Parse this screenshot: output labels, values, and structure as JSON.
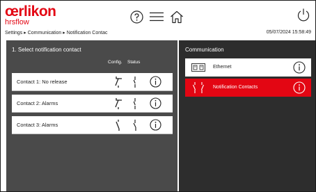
{
  "header": {
    "brand": "œrlikon",
    "product": "hrsflow",
    "breadcrumb": "Settings ▸ Communication ▸ Notification Contac",
    "datetime": "05/07/2024 15:58:49"
  },
  "left_panel": {
    "title": "1. Select notification contact",
    "col_config": "Config.",
    "col_status": "Status",
    "contacts": [
      {
        "label": "Contact 1: No release"
      },
      {
        "label": "Contact 2: Alarms"
      },
      {
        "label": "Contact 3: Alarms"
      }
    ]
  },
  "right_panel": {
    "title": "Communication",
    "items": [
      {
        "label": "Ethernet",
        "icon": "ethernet-port-icon",
        "selected": false
      },
      {
        "label": "Notification Contacts",
        "icon": "relay-contact-icon",
        "selected": true
      }
    ]
  },
  "colors": {
    "brand": "#e30613",
    "left_panel": "#4a4a4a",
    "right_panel": "#2d2d2d",
    "selected": "#e30613"
  }
}
